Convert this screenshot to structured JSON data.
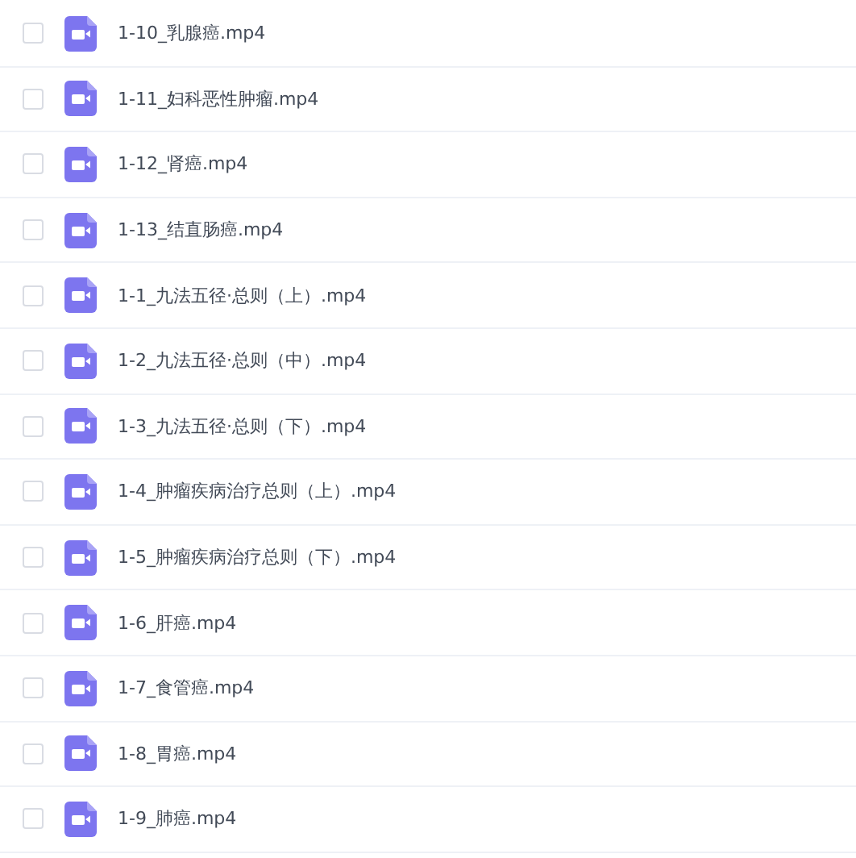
{
  "files": [
    {
      "name": "1-10_乳腺癌.mp4",
      "checked": false
    },
    {
      "name": "1-11_妇科恶性肿瘤.mp4",
      "checked": false
    },
    {
      "name": "1-12_肾癌.mp4",
      "checked": false
    },
    {
      "name": "1-13_结直肠癌.mp4",
      "checked": false
    },
    {
      "name": "1-1_九法五径·总则（上）.mp4",
      "checked": false
    },
    {
      "name": "1-2_九法五径·总则（中）.mp4",
      "checked": false
    },
    {
      "name": "1-3_九法五径·总则（下）.mp4",
      "checked": false
    },
    {
      "name": "1-4_肿瘤疾病治疗总则（上）.mp4",
      "checked": false
    },
    {
      "name": "1-5_肿瘤疾病治疗总则（下）.mp4",
      "checked": false
    },
    {
      "name": "1-6_肝癌.mp4",
      "checked": false
    },
    {
      "name": "1-7_食管癌.mp4",
      "checked": false
    },
    {
      "name": "1-8_胃癌.mp4",
      "checked": false
    },
    {
      "name": "1-9_肺癌.mp4",
      "checked": false
    }
  ]
}
